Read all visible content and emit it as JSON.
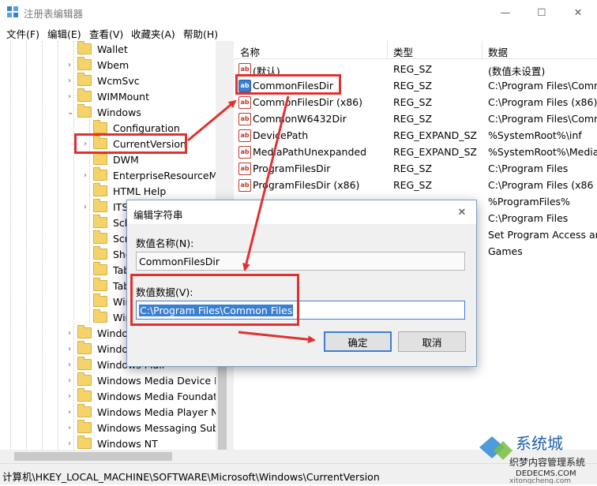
{
  "window": {
    "title": "注册表编辑器",
    "controls": [
      "—",
      "☐",
      "✕"
    ]
  },
  "menu": [
    "文件(F)",
    "编辑(E)",
    "查看(V)",
    "收藏夹(A)",
    "帮助(H)"
  ],
  "tree": {
    "items": [
      {
        "label": "Wallet"
      },
      {
        "label": "Wbem"
      },
      {
        "label": "WcmSvc"
      },
      {
        "label": "WIMMount"
      },
      {
        "label": "Windows"
      },
      {
        "label": "Configuration"
      },
      {
        "label": "CurrentVersion"
      },
      {
        "label": "DWM"
      },
      {
        "label": "EnterpriseResourceMa"
      },
      {
        "label": "HTML Help"
      },
      {
        "label": "ITS"
      },
      {
        "label": "Sch"
      },
      {
        "label": "Scr"
      },
      {
        "label": "She"
      },
      {
        "label": "Tab"
      },
      {
        "label": "Tab"
      },
      {
        "label": "Wir"
      },
      {
        "label": "Wir"
      },
      {
        "label": "Windo"
      },
      {
        "label": "Windo"
      },
      {
        "label": "Windows Mail"
      },
      {
        "label": "Windows Media Device M"
      },
      {
        "label": "Windows Media Foundatio"
      },
      {
        "label": "Windows Media Player NS"
      },
      {
        "label": "Windows Messaging Subs"
      },
      {
        "label": "Windows NT"
      }
    ]
  },
  "list": {
    "headers": {
      "name": "名称",
      "type": "类型",
      "data": "数据"
    },
    "rows": [
      {
        "name": "(默认)",
        "type": "REG_SZ",
        "data": "(数值未设置)"
      },
      {
        "name": "CommonFilesDir",
        "type": "REG_SZ",
        "data": "C:\\Program Files\\Comm"
      },
      {
        "name": "CommonFilesDir (x86)",
        "type": "REG_SZ",
        "data": "C:\\Program Files (x86)\\C"
      },
      {
        "name": "CommonW6432Dir",
        "type": "REG_SZ",
        "data": "C:\\Program Files\\Comm"
      },
      {
        "name": "DevicePath",
        "type": "REG_EXPAND_SZ",
        "data": "%SystemRoot%\\inf"
      },
      {
        "name": "MediaPathUnexpanded",
        "type": "REG_EXPAND_SZ",
        "data": "%SystemRoot%\\Media"
      },
      {
        "name": "ProgramFilesDir",
        "type": "REG_SZ",
        "data": "C:\\Program Files"
      },
      {
        "name": "ProgramFilesDir (x86)",
        "type": "REG_SZ",
        "data": "C:\\Program Files (x86"
      },
      {
        "name": "",
        "type": "",
        "data": "%ProgramFiles%"
      },
      {
        "name": "",
        "type": "",
        "data": "C:\\Program Files"
      },
      {
        "name": "",
        "type": "",
        "data": "Set Program Access and"
      },
      {
        "name": "",
        "type": "",
        "data": "Games"
      }
    ]
  },
  "status": {
    "path": "计算机\\HKEY_LOCAL_MACHINE\\SOFTWARE\\Microsoft\\Windows\\CurrentVersion"
  },
  "dialog": {
    "title": "编辑字符串",
    "close": "✕",
    "name_label": "数值名称(N):",
    "name_value": "CommonFilesDir",
    "data_label": "数值数据(V):",
    "data_value": "C:\\Program Files\\Common Files",
    "ok_label": "确定",
    "cancel_label": "取消"
  },
  "watermark": {
    "brand": "系统城",
    "line1": "织梦内容管理系统",
    "line2": "DEDECMS.COM",
    "line3": "xitongcheng.com"
  },
  "colors": {
    "highlight_red": "#e03131",
    "selection_blue": "#3c7fd1",
    "folder_yellow": "#f6d36a"
  }
}
